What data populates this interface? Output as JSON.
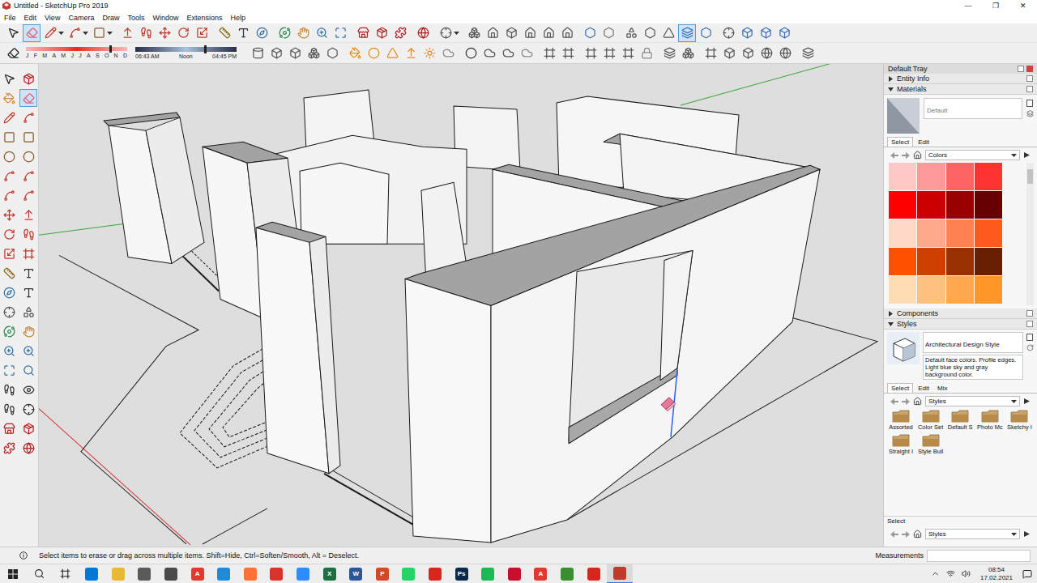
{
  "window": {
    "title": "Untitled - SketchUp Pro 2019",
    "controls": [
      "—",
      "❐",
      "✕"
    ]
  },
  "menu": [
    "File",
    "Edit",
    "View",
    "Camera",
    "Draw",
    "Tools",
    "Window",
    "Extensions",
    "Help"
  ],
  "toolbar_row1": [
    [
      {
        "selected": false
      },
      {
        "selected": true
      },
      {
        "selected": false
      },
      {
        "selected": false
      },
      {
        "selected": false
      }
    ],
    [
      {
        "selected": false
      },
      {
        "selected": false
      },
      {
        "selected": false
      },
      {
        "selected": false
      },
      {
        "selected": false
      }
    ],
    [
      {
        "selected": false
      },
      {
        "selected": false
      },
      {
        "selected": false
      }
    ],
    [
      {
        "selected": false
      },
      {
        "selected": false
      },
      {
        "selected": false
      },
      {
        "selected": false
      }
    ],
    [
      {
        "selected": false
      },
      {
        "selected": false
      },
      {
        "selected": false
      }
    ],
    [
      {
        "selected": false
      }
    ],
    [
      {
        "selected": false
      }
    ],
    [
      {
        "selected": false
      },
      {
        "selected": false
      },
      {
        "selected": false
      },
      {
        "selected": false
      },
      {
        "selected": false
      },
      {
        "selected": false
      }
    ],
    [
      {
        "selected": false
      },
      {
        "selected": false
      }
    ],
    [
      {
        "selected": false
      },
      {
        "selected": false
      },
      {
        "selected": false
      },
      {
        "selected": true
      },
      {
        "selected": false
      }
    ],
    [
      {
        "selected": false
      },
      {
        "selected": false
      },
      {
        "selected": false
      },
      {
        "selected": false
      }
    ]
  ],
  "toolbar_row2": {
    "lead": [
      {
        "selected": false
      }
    ],
    "shadow": {
      "months": [
        "J",
        "F",
        "M",
        "A",
        "M",
        "J",
        "J",
        "A",
        "S",
        "O",
        "N",
        "D"
      ],
      "date_level": 0.82,
      "times": [
        "06:43 AM",
        "Noon",
        "04:45 PM"
      ],
      "time_level": 0.68
    },
    "groups": [
      [
        {
          "selected": false
        },
        {
          "selected": false
        },
        {
          "selected": false
        },
        {
          "selected": false
        },
        {
          "selected": false
        }
      ],
      [
        {
          "selected": false
        },
        {
          "selected": false
        },
        {
          "selected": false
        },
        {
          "selected": false
        },
        {
          "selected": false
        },
        {
          "selected": false
        }
      ],
      [
        {
          "selected": false
        },
        {
          "selected": false
        },
        {
          "selected": false
        },
        {
          "selected": false
        }
      ],
      [
        {
          "selected": false
        },
        {
          "selected": false
        }
      ],
      [
        {
          "selected": false
        },
        {
          "selected": false
        },
        {
          "selected": false
        },
        {
          "selected": false
        }
      ],
      [
        {
          "selected": false
        },
        {
          "selected": false
        }
      ],
      [
        {
          "selected": false
        },
        {
          "selected": false
        },
        {
          "selected": false
        },
        {
          "selected": false
        },
        {
          "selected": false
        }
      ],
      [
        {
          "selected": false
        }
      ]
    ]
  },
  "left_toolbar": [
    {
      "selected": false
    },
    {
      "selected": false
    },
    {
      "selected": false
    },
    {
      "selected": true
    },
    {
      "selected": false
    },
    {
      "selected": false
    },
    {
      "selected": false
    },
    {
      "selected": false
    },
    {
      "selected": false
    },
    {
      "selected": false
    },
    {
      "selected": false
    },
    {
      "selected": false
    },
    {
      "selected": false
    },
    {
      "selected": false
    },
    {
      "selected": false
    },
    {
      "selected": false
    },
    {
      "selected": false
    },
    {
      "selected": false
    },
    {
      "selected": false
    },
    {
      "selected": false
    },
    {
      "selected": false
    },
    {
      "selected": false
    },
    {
      "selected": false
    },
    {
      "selected": false
    },
    {
      "selected": false
    },
    {
      "selected": false
    },
    {
      "selected": false
    },
    {
      "selected": false
    },
    {
      "selected": false
    },
    {
      "selected": false
    },
    {
      "selected": false
    },
    {
      "selected": false
    },
    {
      "selected": false
    },
    {
      "selected": false
    },
    {
      "selected": false
    },
    {
      "selected": false
    },
    {
      "selected": false
    },
    {
      "selected": false
    },
    {
      "selected": false
    },
    {
      "selected": false
    }
  ],
  "tray": {
    "title": "Default Tray",
    "entity_info": {
      "label": "Entity Info",
      "expanded": false
    },
    "materials": {
      "label": "Materials",
      "expanded": true,
      "name": "Default",
      "tabs": [
        {
          "label": "Select",
          "selected": true
        },
        {
          "label": "Edit",
          "selected": false
        }
      ],
      "library": "Colors",
      "swatches": [
        {
          "color": "#ffc8c8"
        },
        {
          "color": "#ff9a9a"
        },
        {
          "color": "#ff6464"
        },
        {
          "color": "#ff3232"
        },
        {
          "color": "#ff0000"
        },
        {
          "color": "#cc0000"
        },
        {
          "color": "#990000"
        },
        {
          "color": "#660000"
        },
        {
          "color": "#ffd8c8"
        },
        {
          "color": "#ffa88c"
        },
        {
          "color": "#ff8050"
        },
        {
          "color": "#ff5a1e"
        },
        {
          "color": "#ff5000"
        },
        {
          "color": "#cc4000"
        },
        {
          "color": "#993000"
        },
        {
          "color": "#662000"
        },
        {
          "color": "#ffdcb4"
        },
        {
          "color": "#ffc080"
        },
        {
          "color": "#ffa850"
        },
        {
          "color": "#ff9628"
        }
      ]
    },
    "components": {
      "label": "Components",
      "expanded": false
    },
    "styles": {
      "label": "Styles",
      "expanded": true,
      "name": "Architectural Design Style",
      "description": "Default face colors. Profile edges. Light blue sky and gray background color.",
      "tabs": [
        {
          "label": "Select",
          "selected": true
        },
        {
          "label": "Edit",
          "selected": false
        },
        {
          "label": "Mix",
          "selected": false
        }
      ],
      "library": "Styles",
      "folders": [
        "Assorted",
        "Color Set",
        "Default S",
        "Photo Mc",
        "Sketchy I",
        "Straight I",
        "Style Buil"
      ]
    },
    "secondary": {
      "label": "Select",
      "library": "Styles"
    }
  },
  "status": {
    "hint": "Select items to erase or drag across multiple items. Shift=Hide, Ctrl=Soften/Smooth, Alt = Deselect.",
    "measurements_label": "Measurements"
  },
  "taskbar": {
    "apps": [
      {
        "label": "",
        "color": "#0078d7",
        "selected": false
      },
      {
        "label": "",
        "color": "#e8b935",
        "selected": false
      },
      {
        "label": "",
        "color": "#5a5a5a",
        "selected": false
      },
      {
        "label": "",
        "color": "#4a4a4a",
        "selected": false
      },
      {
        "label": "A",
        "color": "#e03a2f",
        "selected": false
      },
      {
        "label": "",
        "color": "#1f8bd8",
        "selected": false
      },
      {
        "label": "",
        "color": "#ff7139",
        "selected": false
      },
      {
        "label": "",
        "color": "#d9342b",
        "selected": false
      },
      {
        "label": "",
        "color": "#2d8cff",
        "selected": false
      },
      {
        "label": "X",
        "color": "#1d6f42",
        "selected": false
      },
      {
        "label": "W",
        "color": "#2b579a",
        "selected": false
      },
      {
        "label": "P",
        "color": "#d24726",
        "selected": false
      },
      {
        "label": "",
        "color": "#25d366",
        "selected": false
      },
      {
        "label": "",
        "color": "#d7261e",
        "selected": false
      },
      {
        "label": "Ps",
        "color": "#0b2a4a",
        "selected": false
      },
      {
        "label": "",
        "color": "#1db954",
        "selected": false
      },
      {
        "label": "",
        "color": "#c8102e",
        "selected": false
      },
      {
        "label": "A",
        "color": "#e03a2f",
        "selected": false
      },
      {
        "label": "",
        "color": "#3c8d2f",
        "selected": false
      },
      {
        "label": "",
        "color": "#d7261e",
        "selected": false
      },
      {
        "label": "",
        "color": "#c0392b",
        "selected": true
      }
    ],
    "time": "08:54",
    "date": "17.02.2021"
  }
}
